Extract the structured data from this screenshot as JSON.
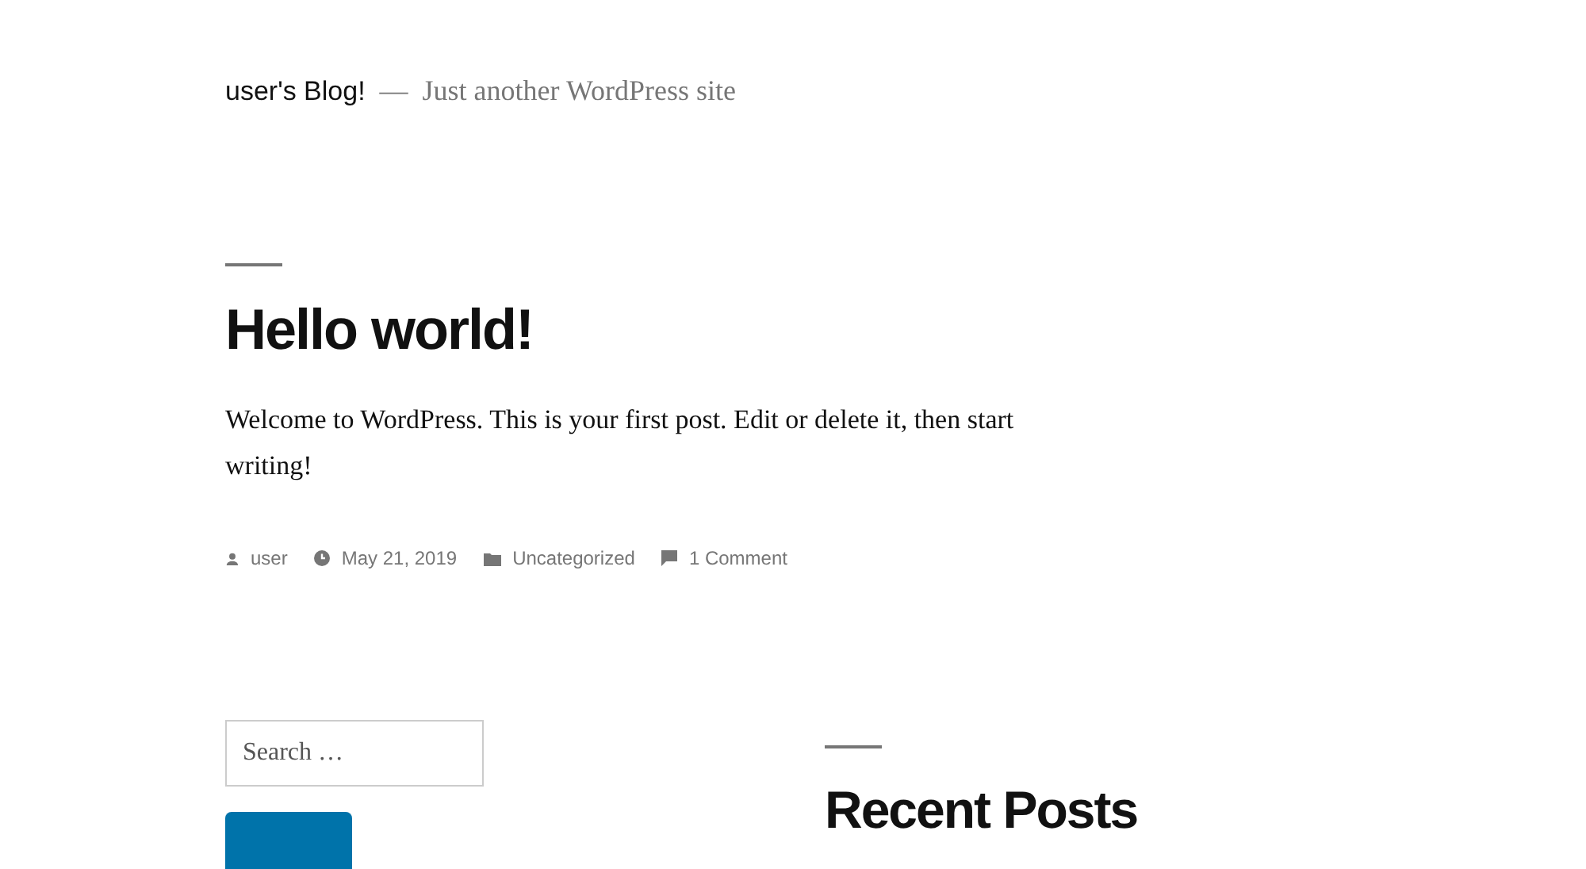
{
  "site": {
    "title": "user's Blog!",
    "separator": "—",
    "tagline": "Just another WordPress site"
  },
  "post": {
    "title": "Hello world!",
    "body": "Welcome to WordPress. This is your first post. Edit or delete it, then start writing!",
    "meta": [
      {
        "kind": "author",
        "text": "user"
      },
      {
        "kind": "date",
        "text": "May 21, 2019"
      },
      {
        "kind": "category",
        "text": "Uncategorized"
      },
      {
        "kind": "comments",
        "text": "1 Comment"
      }
    ]
  },
  "widgets": {
    "search": {
      "placeholder": "Search …"
    },
    "recent_posts": {
      "title": "Recent Posts"
    }
  }
}
